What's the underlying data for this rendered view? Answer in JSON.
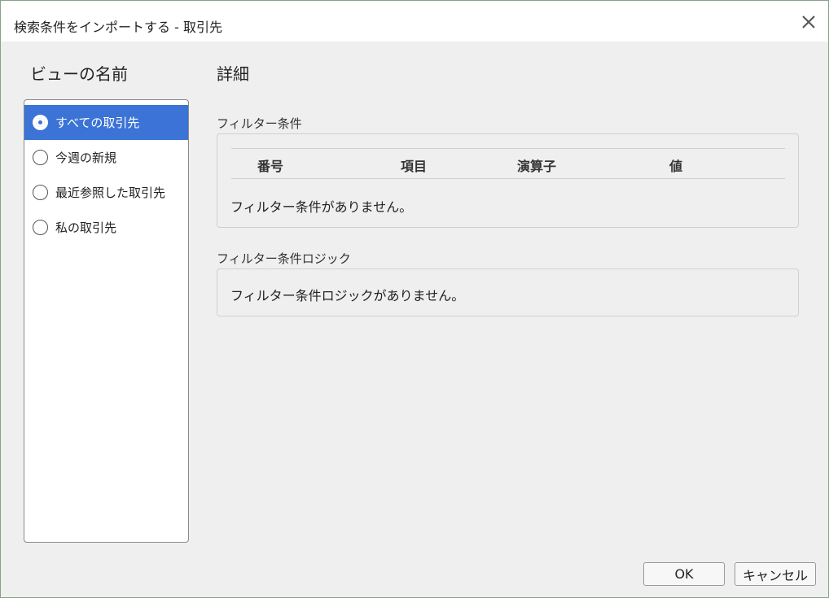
{
  "window": {
    "title": "検索条件をインポートする - 取引先",
    "close_icon": "close-icon"
  },
  "views": {
    "heading": "ビューの名前",
    "items": [
      {
        "label": "すべての取引先",
        "selected": true
      },
      {
        "label": "今週の新規",
        "selected": false
      },
      {
        "label": "最近参照した取引先",
        "selected": false
      },
      {
        "label": "私の取引先",
        "selected": false
      }
    ]
  },
  "details": {
    "heading": "詳細",
    "filter": {
      "label": "フィルター条件",
      "columns": [
        "番号",
        "項目",
        "演算子",
        "値"
      ],
      "empty_text": "フィルター条件がありません。"
    },
    "logic": {
      "label": "フィルター条件ロジック",
      "empty_text": "フィルター条件ロジックがありません。"
    }
  },
  "buttons": {
    "ok": "OK",
    "cancel": "キャンセル"
  },
  "colors": {
    "selected": "#3b73d6",
    "background": "#efefef"
  }
}
